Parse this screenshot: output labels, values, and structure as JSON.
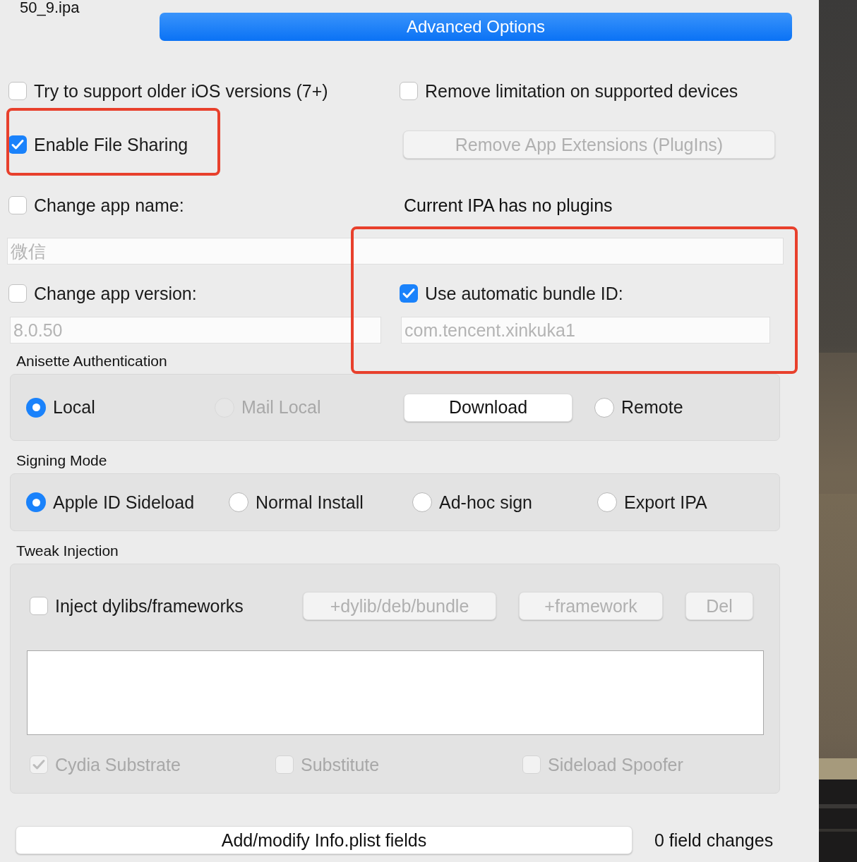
{
  "file_name": "50_9.ipa",
  "advanced_button": "Advanced Options",
  "older_ios": {
    "label": "Try to support older iOS versions (7+)",
    "checked": false
  },
  "remove_limitation": {
    "label": "Remove limitation on supported devices",
    "checked": false
  },
  "file_sharing": {
    "label": "Enable File Sharing",
    "checked": true,
    "highlighted": true
  },
  "remove_extensions_button": {
    "label": "Remove App Extensions (PlugIns)",
    "disabled": true
  },
  "change_name": {
    "label": "Change app name:",
    "checked": false
  },
  "plugins_note": "Current IPA has no plugins",
  "name_field": {
    "value": "微信",
    "disabled": true
  },
  "change_version": {
    "label": "Change app version:",
    "checked": false
  },
  "auto_bundle": {
    "label": "Use automatic bundle ID:",
    "checked": true,
    "highlighted": true
  },
  "version_field": {
    "value": "8.0.50",
    "disabled": true
  },
  "bundle_field": {
    "value": "com.tencent.xinkuka1",
    "disabled": true
  },
  "anisette": {
    "title": "Anisette Authentication",
    "options": [
      {
        "kind": "radio",
        "label": "Local",
        "selected": true,
        "disabled": false
      },
      {
        "kind": "radio",
        "label": "Mail Local",
        "selected": false,
        "disabled": true
      },
      {
        "kind": "button",
        "label": "Download"
      },
      {
        "kind": "radio",
        "label": "Remote",
        "selected": false,
        "disabled": false
      }
    ]
  },
  "signing": {
    "title": "Signing Mode",
    "options": [
      {
        "label": "Apple ID Sideload",
        "selected": true
      },
      {
        "label": "Normal Install",
        "selected": false
      },
      {
        "label": "Ad-hoc sign",
        "selected": false
      },
      {
        "label": "Export IPA",
        "selected": false
      }
    ]
  },
  "tweak": {
    "title": "Tweak Injection",
    "inject": {
      "label": "Inject dylibs/frameworks",
      "checked": false
    },
    "buttons": [
      {
        "label": "+dylib/deb/bundle",
        "disabled": true
      },
      {
        "label": "+framework",
        "disabled": true
      },
      {
        "label": "Del",
        "disabled": true
      }
    ],
    "frameworks": [
      {
        "label": "Cydia Substrate",
        "checked": true,
        "disabled": true
      },
      {
        "label": "Substitute",
        "checked": false,
        "disabled": true
      },
      {
        "label": "Sideload Spoofer",
        "checked": false,
        "disabled": true
      }
    ]
  },
  "footer": {
    "button": "Add/modify Info.plist fields",
    "changes": "0 field changes"
  }
}
